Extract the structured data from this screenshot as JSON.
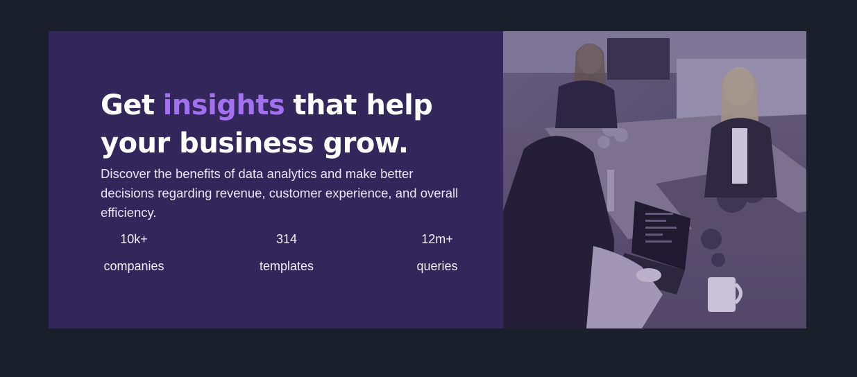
{
  "hero": {
    "headline_part1": "Get",
    "headline_accent": "insights",
    "headline_part2": "that help",
    "headline_line2": "your business grow.",
    "description": "Discover the benefits of data analytics and make better decisions regarding revenue, customer experience, and overall efficiency.",
    "stats": [
      {
        "value": "10k+",
        "label": "companies"
      },
      {
        "value": "314",
        "label": "templates"
      },
      {
        "value": "12m+",
        "label": "queries"
      }
    ]
  },
  "colors": {
    "page_background": "#1b1f2b",
    "panel_background": "#33265a",
    "accent": "#a371f0",
    "text": "#ffffff"
  },
  "image": {
    "subject": "office-team-photo"
  }
}
